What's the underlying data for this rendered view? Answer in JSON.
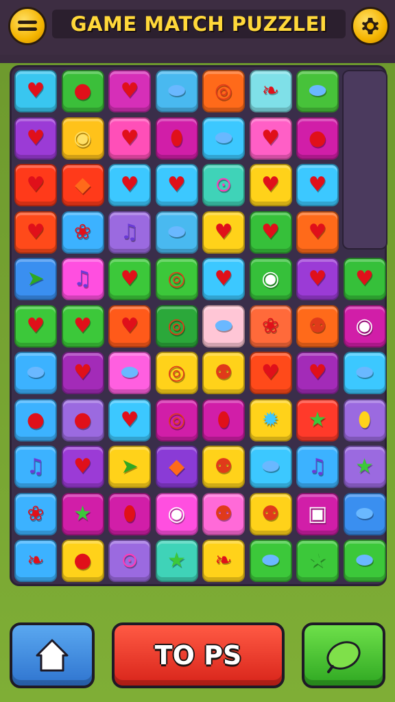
{
  "header": {
    "title": "GAME MATCH PUZZLEI",
    "menu_icon": "menu-icon",
    "settings_icon": "settings-icon"
  },
  "board": {
    "columns": 8,
    "rows": 11,
    "empty_slot": "column 8, rows 1-4",
    "tiles": [
      [
        {
          "c": "#39c6f0",
          "g": "heart"
        },
        {
          "c": "#3bbf3a",
          "g": "apple"
        },
        {
          "c": "#d62fb8",
          "g": "heart"
        },
        {
          "c": "#49b9f0",
          "g": "leaf"
        },
        {
          "c": "#ff6a1a",
          "g": "donut"
        },
        {
          "c": "#7fe0e8",
          "g": "pepper"
        },
        {
          "c": "#47c23a",
          "g": "leaf"
        },
        null
      ],
      [
        {
          "c": "#9b3bd6",
          "g": "heart"
        },
        {
          "c": "#ffc21a",
          "g": "pear"
        },
        {
          "c": "#ff4fb8",
          "g": "heart"
        },
        {
          "c": "#d11ea8",
          "g": "bean"
        },
        {
          "c": "#3cc8ff",
          "g": "leaf"
        },
        {
          "c": "#ff5fc6",
          "g": "heart"
        },
        {
          "c": "#d11ea8",
          "g": "apple"
        },
        null
      ],
      [
        {
          "c": "#ff3a1a",
          "g": "heart"
        },
        {
          "c": "#ff3a1a",
          "g": "drop"
        },
        {
          "c": "#3cc8ff",
          "g": "heart"
        },
        {
          "c": "#3cc8ff",
          "g": "heart"
        },
        {
          "c": "#3fd3b8",
          "g": "bottle"
        },
        {
          "c": "#ffd21a",
          "g": "heart"
        },
        {
          "c": "#3cc8ff",
          "g": "heart"
        },
        null
      ],
      [
        {
          "c": "#ff4a1a",
          "g": "heart"
        },
        {
          "c": "#3cb2ff",
          "g": "berry"
        },
        {
          "c": "#9b6ae0",
          "g": "note"
        },
        {
          "c": "#49b9f0",
          "g": "leaf"
        },
        {
          "c": "#ffd21a",
          "g": "heart"
        },
        {
          "c": "#36c03a",
          "g": "heart"
        },
        {
          "c": "#ff6a1a",
          "g": "heart"
        },
        null
      ],
      [
        {
          "c": "#3a8ff0",
          "g": "carrot"
        },
        {
          "c": "#ff4fe0",
          "g": "note"
        },
        {
          "c": "#3cc83a",
          "g": "heart"
        },
        {
          "c": "#3cc83a",
          "g": "donut"
        },
        {
          "c": "#3cc8ff",
          "g": "heart"
        },
        {
          "c": "#36c03a",
          "g": "eye"
        },
        {
          "c": "#9b3bd6",
          "g": "heart"
        },
        {
          "c": "#36c03a",
          "g": "heart"
        }
      ],
      [
        {
          "c": "#3cc83a",
          "g": "heart"
        },
        {
          "c": "#3cc83a",
          "g": "heart"
        },
        {
          "c": "#ff5a1a",
          "g": "heart"
        },
        {
          "c": "#2ba83a",
          "g": "donut"
        },
        {
          "c": "#ffc6d6",
          "g": "leaf"
        },
        {
          "c": "#ff6a3a",
          "g": "berry"
        },
        {
          "c": "#ff6a1a",
          "g": "pop"
        },
        {
          "c": "#d11ea8",
          "g": "eye"
        }
      ],
      [
        {
          "c": "#3cb2ff",
          "g": "leaf"
        },
        {
          "c": "#a32bb8",
          "g": "heart"
        },
        {
          "c": "#ff5fe0",
          "g": "leaf"
        },
        {
          "c": "#ffd21a",
          "g": "donut"
        },
        {
          "c": "#ffd21a",
          "g": "pop"
        },
        {
          "c": "#ff4a1a",
          "g": "heart"
        },
        {
          "c": "#a32bb8",
          "g": "heart"
        },
        {
          "c": "#3cc8ff",
          "g": "leaf"
        }
      ],
      [
        {
          "c": "#3cb2ff",
          "g": "apple"
        },
        {
          "c": "#9b6ae0",
          "g": "apple"
        },
        {
          "c": "#3cc8ff",
          "g": "heart"
        },
        {
          "c": "#d11ea8",
          "g": "donut"
        },
        {
          "c": "#d11ea8",
          "g": "bean"
        },
        {
          "c": "#ffd21a",
          "g": "splat"
        },
        {
          "c": "#ff3a2a",
          "g": "star"
        },
        {
          "c": "#9b6ae0",
          "g": "balloon"
        }
      ],
      [
        {
          "c": "#3cb2ff",
          "g": "note"
        },
        {
          "c": "#9b3bd6",
          "g": "heart"
        },
        {
          "c": "#ffd21a",
          "g": "carrot"
        },
        {
          "c": "#8a3bd6",
          "g": "drop"
        },
        {
          "c": "#ffd21a",
          "g": "pop"
        },
        {
          "c": "#3cc8ff",
          "g": "leaf"
        },
        {
          "c": "#3cb2ff",
          "g": "note"
        },
        {
          "c": "#9b6ae0",
          "g": "star"
        }
      ],
      [
        {
          "c": "#3cb2ff",
          "g": "berry"
        },
        {
          "c": "#d11ea8",
          "g": "star"
        },
        {
          "c": "#d11ea8",
          "g": "bean"
        },
        {
          "c": "#ff4fe0",
          "g": "eye"
        },
        {
          "c": "#ff6ad8",
          "g": "pop"
        },
        {
          "c": "#ffd21a",
          "g": "pop"
        },
        {
          "c": "#d11ea8",
          "g": "robot"
        },
        {
          "c": "#3a8ff0",
          "g": "leaf"
        }
      ],
      [
        {
          "c": "#3cb2ff",
          "g": "pepper"
        },
        {
          "c": "#ffd21a",
          "g": "apple"
        },
        {
          "c": "#9b6ae0",
          "g": "bottle"
        },
        {
          "c": "#3fd3b8",
          "g": "star"
        },
        {
          "c": "#ffd21a",
          "g": "pepper"
        },
        {
          "c": "#3cc83a",
          "g": "leaf"
        },
        {
          "c": "#3cc83a",
          "g": "star"
        },
        {
          "c": "#3cc83a",
          "g": "leaf"
        }
      ]
    ]
  },
  "footer": {
    "home_icon": "home-icon",
    "center_label": "TO PS",
    "lime_icon": "lime-icon"
  },
  "colors": {
    "topbar": "#3d2d42",
    "board_bg": "#3a2e4a",
    "title_gold": "#ffd83a",
    "home_button": "#2f74cf",
    "center_button": "#d8241a",
    "go_button": "#2fa822"
  }
}
